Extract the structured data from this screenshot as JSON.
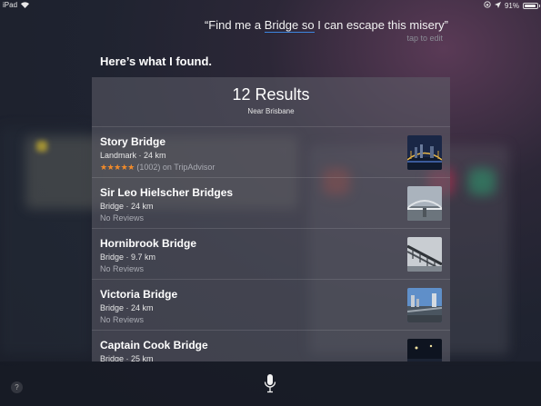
{
  "status_bar": {
    "device": "iPad",
    "battery_text": "91%",
    "battery_level": 0.91
  },
  "siri": {
    "query_before": "“Find me a ",
    "query_underlined": "Bridge so",
    "query_after": " I can escape this misery”",
    "tap_to_edit": "tap to edit",
    "response": "Here’s what I found."
  },
  "results": {
    "title": "12 Results",
    "subtitle": "Near Brisbane",
    "items": [
      {
        "name": "Story Bridge",
        "meta": "Landmark · 24 km",
        "stars": "★★★★★",
        "reviews": "(1002) on TripAdvisor",
        "thumb_icon": "story-bridge-night-photo"
      },
      {
        "name": "Sir Leo Hielscher Bridges",
        "meta": "Bridge · 24 km",
        "stars": "",
        "reviews": "No Reviews",
        "thumb_icon": "gateway-bridge-photo"
      },
      {
        "name": "Hornibrook Bridge",
        "meta": "Bridge · 9.7 km",
        "stars": "",
        "reviews": "No Reviews",
        "thumb_icon": "hornibrook-bridge-photo"
      },
      {
        "name": "Victoria Bridge",
        "meta": "Bridge · 24 km",
        "stars": "",
        "reviews": "No Reviews",
        "thumb_icon": "victoria-bridge-photo"
      },
      {
        "name": "Captain Cook Bridge",
        "meta": "Bridge · 25 km",
        "stars": "",
        "reviews": "",
        "thumb_icon": "captain-cook-bridge-photo"
      }
    ]
  },
  "bottom": {
    "help_label": "?",
    "mic_icon": "microphone-icon"
  },
  "colors": {
    "underline": "#3d86e0",
    "stars": "#f28b2a"
  }
}
